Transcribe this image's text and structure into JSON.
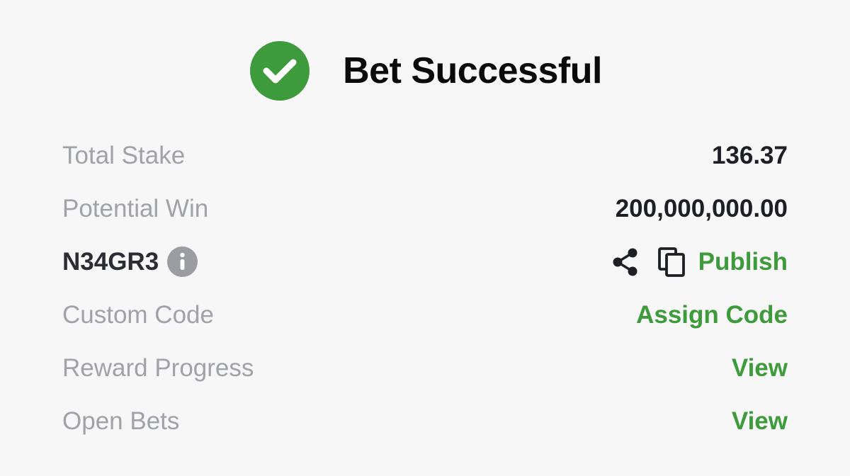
{
  "header": {
    "title": "Bet Successful",
    "icon": "check-circle-icon",
    "success_color": "#3d9b3b"
  },
  "summary": {
    "total_stake": {
      "label": "Total Stake",
      "value": "136.37"
    },
    "potential_win": {
      "label": "Potential Win",
      "value": "200,000,000.00"
    },
    "booking": {
      "code": "N34GR3",
      "info_icon": "info-icon",
      "share_icon": "share-icon",
      "copy_icon": "copy-icon",
      "publish_label": "Publish"
    },
    "custom_code": {
      "label": "Custom Code",
      "action": "Assign Code"
    },
    "reward_progress": {
      "label": "Reward Progress",
      "action": "View"
    },
    "open_bets": {
      "label": "Open Bets",
      "action": "View"
    }
  },
  "colors": {
    "accent": "#3d9b3b",
    "muted_text": "#a0a2a8",
    "strong_text": "#1d1f24",
    "background": "#f7f7f8"
  }
}
